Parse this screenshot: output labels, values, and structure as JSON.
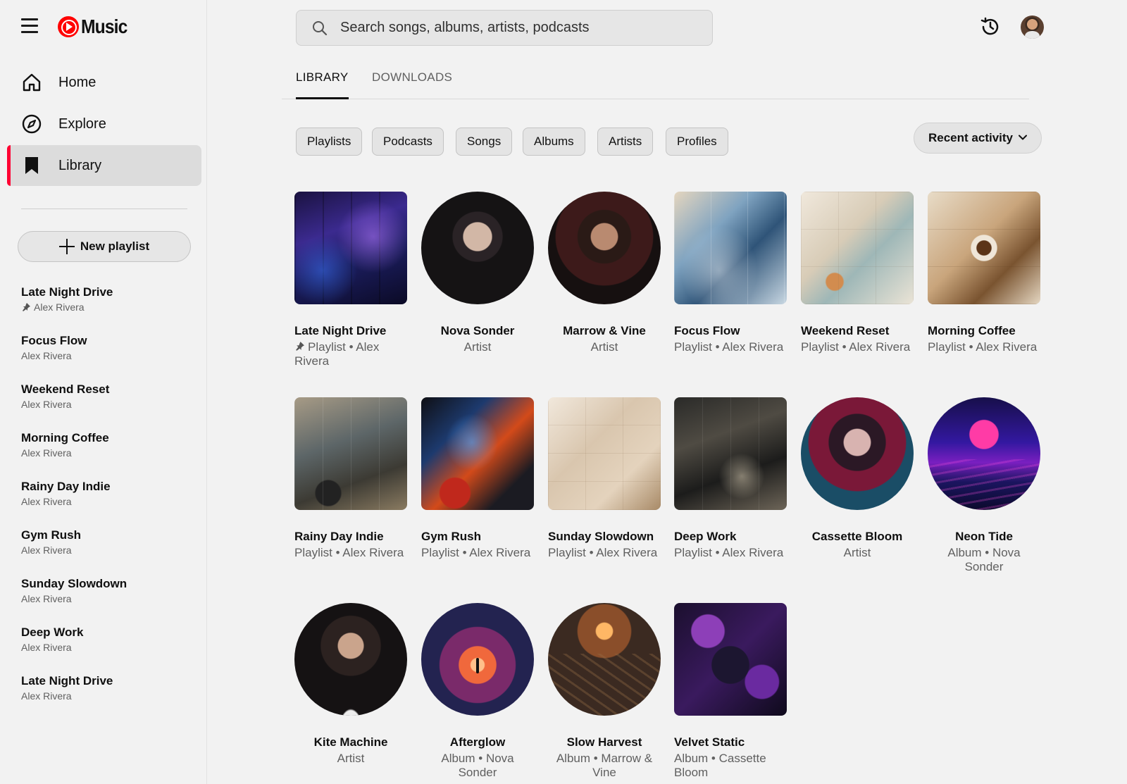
{
  "app": {
    "name": "Music"
  },
  "nav": [
    {
      "label": "Home",
      "icon": "home-icon"
    },
    {
      "label": "Explore",
      "icon": "compass-icon"
    },
    {
      "label": "Library",
      "icon": "library-bookmark-icon",
      "active": true
    }
  ],
  "sidebar": {
    "new_playlist_label": "New playlist",
    "playlists": [
      {
        "title": "Late Night Drive",
        "subtitle": "Alex Rivera",
        "pinned": true
      },
      {
        "title": "Focus Flow",
        "subtitle": "Alex Rivera"
      },
      {
        "title": "Weekend Reset",
        "subtitle": "Alex Rivera"
      },
      {
        "title": "Morning Coffee",
        "subtitle": "Alex Rivera"
      },
      {
        "title": "Rainy Day Indie",
        "subtitle": "Alex Rivera"
      },
      {
        "title": "Gym Rush",
        "subtitle": "Alex Rivera"
      },
      {
        "title": "Sunday Slowdown",
        "subtitle": "Alex Rivera"
      },
      {
        "title": "Deep Work",
        "subtitle": "Alex Rivera"
      },
      {
        "title": "Late Night Drive",
        "subtitle": "Alex Rivera"
      }
    ]
  },
  "search": {
    "placeholder": "Search songs, albums, artists, podcasts"
  },
  "tabs": [
    {
      "label": "LIBRARY",
      "active": true
    },
    {
      "label": "DOWNLOADS",
      "active": false
    }
  ],
  "chips": [
    "Playlists",
    "Podcasts",
    "Songs",
    "Albums",
    "Artists",
    "Profiles"
  ],
  "sort": {
    "label": "Recent activity"
  },
  "grid": [
    {
      "title": "Late Night Drive",
      "subtitle": "Playlist • Alex Rivera",
      "shape": "square",
      "pinned": true
    },
    {
      "title": "Nova Sonder",
      "subtitle": "Artist",
      "shape": "round"
    },
    {
      "title": "Marrow & Vine",
      "subtitle": "Artist",
      "shape": "round"
    },
    {
      "title": "Focus Flow",
      "subtitle": "Playlist • Alex Rivera",
      "shape": "square"
    },
    {
      "title": "Weekend Reset",
      "subtitle": "Playlist • Alex Rivera",
      "shape": "square"
    },
    {
      "title": "Morning Coffee",
      "subtitle": "Playlist • Alex Rivera",
      "shape": "square"
    },
    {
      "title": "Rainy Day Indie",
      "subtitle": "Playlist • Alex Rivera",
      "shape": "square"
    },
    {
      "title": "Gym Rush",
      "subtitle": "Playlist • Alex Rivera",
      "shape": "square"
    },
    {
      "title": "Sunday Slowdown",
      "subtitle": "Playlist • Alex Rivera",
      "shape": "square"
    },
    {
      "title": "Deep Work",
      "subtitle": "Playlist • Alex Rivera",
      "shape": "square"
    },
    {
      "title": "Cassette Bloom",
      "subtitle": "Artist",
      "shape": "round"
    },
    {
      "title": "Neon Tide",
      "subtitle": "Album • Nova Sonder",
      "shape": "round"
    },
    {
      "title": "Kite Machine",
      "subtitle": "Artist",
      "shape": "round"
    },
    {
      "title": "Afterglow",
      "subtitle": "Album • Nova Sonder",
      "shape": "round"
    },
    {
      "title": "Slow Harvest",
      "subtitle": "Album • Marrow & Vine",
      "shape": "round"
    },
    {
      "title": "Velvet Static",
      "subtitle": "Album • Cassette Bloom",
      "shape": "square"
    }
  ],
  "colors": {
    "accent": "#ff0033",
    "brand": "#ff0000",
    "background": "#f2f2f2"
  }
}
